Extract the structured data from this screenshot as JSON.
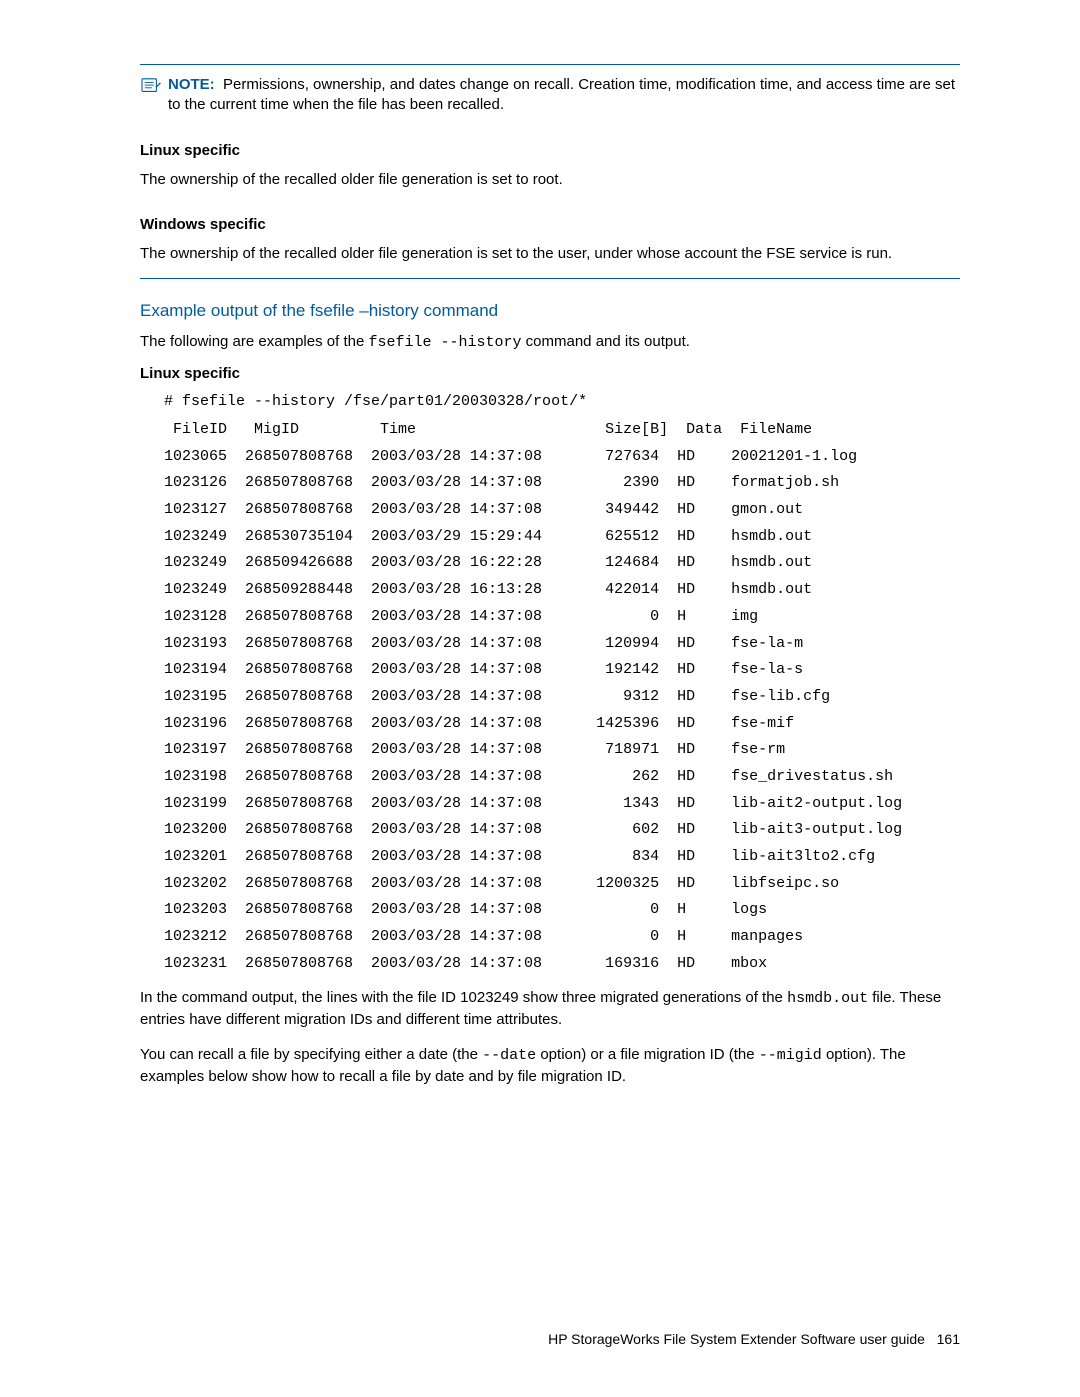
{
  "note": {
    "label": "NOTE:",
    "text": "Permissions, ownership, and dates change on recall. Creation time, modification time, and access time are set to the current time when the file has been recalled."
  },
  "linux1": {
    "heading": "Linux specific",
    "text": "The ownership of the recalled older file generation is set to root."
  },
  "windows": {
    "heading": "Windows specific",
    "text": "The ownership of the recalled older file generation is set to the user, under whose account the FSE service is run."
  },
  "blueHead": "Example output of the fsefile –history command",
  "introPre": "The following are examples of the ",
  "introCode": "fsefile --history",
  "introPost": " command and its output.",
  "linux2": {
    "heading": "Linux specific"
  },
  "cmd": "# fsefile --history /fse/part01/20030328/root/*",
  "cols": {
    "FileID": "FileID",
    "MigID": "MigID",
    "Time": "Time",
    "Size": "Size[B]",
    "Data": "Data",
    "FileName": "FileName"
  },
  "rows": [
    {
      "FileID": "1023065",
      "MigID": "268507808768",
      "Time": "2003/03/28 14:37:08",
      "Size": "727634",
      "Data": "HD",
      "FileName": "20021201-1.log"
    },
    {
      "FileID": "1023126",
      "MigID": "268507808768",
      "Time": "2003/03/28 14:37:08",
      "Size": "2390",
      "Data": "HD",
      "FileName": "formatjob.sh"
    },
    {
      "FileID": "1023127",
      "MigID": "268507808768",
      "Time": "2003/03/28 14:37:08",
      "Size": "349442",
      "Data": "HD",
      "FileName": "gmon.out"
    },
    {
      "FileID": "1023249",
      "MigID": "268530735104",
      "Time": "2003/03/29 15:29:44",
      "Size": "625512",
      "Data": "HD",
      "FileName": "hsmdb.out"
    },
    {
      "FileID": "1023249",
      "MigID": "268509426688",
      "Time": "2003/03/28 16:22:28",
      "Size": "124684",
      "Data": "HD",
      "FileName": "hsmdb.out"
    },
    {
      "FileID": "1023249",
      "MigID": "268509288448",
      "Time": "2003/03/28 16:13:28",
      "Size": "422014",
      "Data": "HD",
      "FileName": "hsmdb.out"
    },
    {
      "FileID": "1023128",
      "MigID": "268507808768",
      "Time": "2003/03/28 14:37:08",
      "Size": "0",
      "Data": "H",
      "FileName": "img"
    },
    {
      "FileID": "1023193",
      "MigID": "268507808768",
      "Time": "2003/03/28 14:37:08",
      "Size": "120994",
      "Data": "HD",
      "FileName": "fse-la-m"
    },
    {
      "FileID": "1023194",
      "MigID": "268507808768",
      "Time": "2003/03/28 14:37:08",
      "Size": "192142",
      "Data": "HD",
      "FileName": "fse-la-s"
    },
    {
      "FileID": "1023195",
      "MigID": "268507808768",
      "Time": "2003/03/28 14:37:08",
      "Size": "9312",
      "Data": "HD",
      "FileName": "fse-lib.cfg"
    },
    {
      "FileID": "1023196",
      "MigID": "268507808768",
      "Time": "2003/03/28 14:37:08",
      "Size": "1425396",
      "Data": "HD",
      "FileName": "fse-mif"
    },
    {
      "FileID": "1023197",
      "MigID": "268507808768",
      "Time": "2003/03/28 14:37:08",
      "Size": "718971",
      "Data": "HD",
      "FileName": "fse-rm"
    },
    {
      "FileID": "1023198",
      "MigID": "268507808768",
      "Time": "2003/03/28 14:37:08",
      "Size": "262",
      "Data": "HD",
      "FileName": "fse_drivestatus.sh"
    },
    {
      "FileID": "1023199",
      "MigID": "268507808768",
      "Time": "2003/03/28 14:37:08",
      "Size": "1343",
      "Data": "HD",
      "FileName": "lib-ait2-output.log"
    },
    {
      "FileID": "1023200",
      "MigID": "268507808768",
      "Time": "2003/03/28 14:37:08",
      "Size": "602",
      "Data": "HD",
      "FileName": "lib-ait3-output.log"
    },
    {
      "FileID": "1023201",
      "MigID": "268507808768",
      "Time": "2003/03/28 14:37:08",
      "Size": "834",
      "Data": "HD",
      "FileName": "lib-ait3lto2.cfg"
    },
    {
      "FileID": "1023202",
      "MigID": "268507808768",
      "Time": "2003/03/28 14:37:08",
      "Size": "1200325",
      "Data": "HD",
      "FileName": "libfseipc.so"
    },
    {
      "FileID": "1023203",
      "MigID": "268507808768",
      "Time": "2003/03/28 14:37:08",
      "Size": "0",
      "Data": "H",
      "FileName": "logs"
    },
    {
      "FileID": "1023212",
      "MigID": "268507808768",
      "Time": "2003/03/28 14:37:08",
      "Size": "0",
      "Data": "H",
      "FileName": "manpages"
    },
    {
      "FileID": "1023231",
      "MigID": "268507808768",
      "Time": "2003/03/28 14:37:08",
      "Size": "169316",
      "Data": "HD",
      "FileName": "mbox"
    }
  ],
  "after1": {
    "pre": "In the command output, the lines with the file ID 1023249 show three migrated generations of the ",
    "code": "hsmdb.out",
    "post": " file. These entries have different migration IDs and different time attributes."
  },
  "after2": {
    "pre": "You can recall a file by specifying either a date (the ",
    "code1": "--date",
    "mid": " option) or a file migration ID (the ",
    "code2": "--migid",
    "post": " option). The examples below show how to recall a file by date and by file migration ID."
  },
  "footerTitle": "HP StorageWorks File System Extender Software user guide",
  "footerPage": "161"
}
